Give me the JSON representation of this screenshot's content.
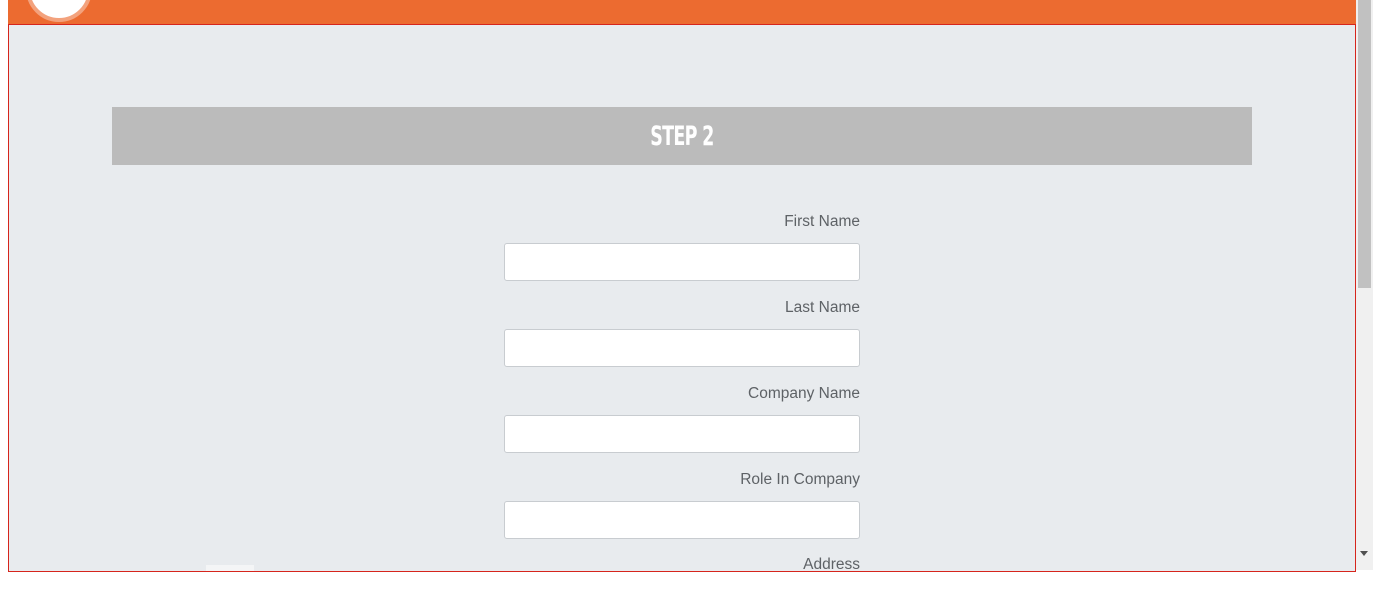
{
  "step": {
    "title": "STEP 2"
  },
  "form": {
    "fields": [
      {
        "label": "First Name",
        "value": ""
      },
      {
        "label": "Last Name",
        "value": ""
      },
      {
        "label": "Company Name",
        "value": ""
      },
      {
        "label": "Role In Company",
        "value": ""
      }
    ],
    "partial_label": "Address"
  },
  "colors": {
    "top_bar": "#ec6b30",
    "page_background": "#e8ebee",
    "header_band": "#bbbbbb",
    "frame_border": "#d6251c",
    "label_text": "#5e6266"
  },
  "icons": [
    "logo-icon",
    "scroll-down-arrow-icon"
  ]
}
